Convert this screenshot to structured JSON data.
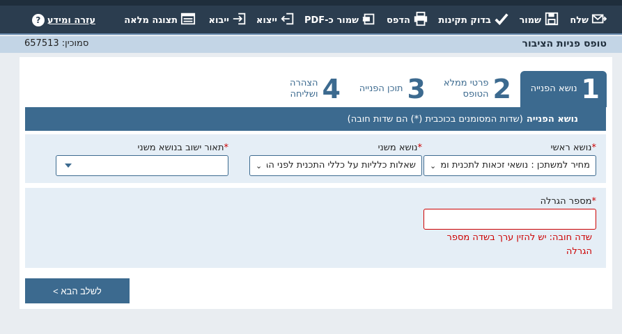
{
  "toolbar": {
    "send": "שלח",
    "save": "שמור",
    "validate": "בדוק תקינות",
    "print": "הדפס",
    "save_pdf": "שמור כ-PDF",
    "export": "ייצוא",
    "import": "ייבוא",
    "fullscreen": "תצוגה מלאה",
    "help": "עזרה ומידע",
    "help_icon": "?"
  },
  "header": {
    "title": "טופס פניות הציבור",
    "reference": "סמוכין: 657513"
  },
  "steps": [
    {
      "num": "1",
      "label": "נושא הפנייה"
    },
    {
      "num": "2",
      "label": "פרטי ממלא הטופס"
    },
    {
      "num": "3",
      "label": "תוכן הפנייה"
    },
    {
      "num": "4",
      "label": "הצהרה ושליחה"
    }
  ],
  "section": {
    "title": "נושא הפנייה",
    "note": "(שדות המסומנים בכוכבית (*) הם שדות חובה)"
  },
  "fields": {
    "req_mark": "*",
    "main_topic": {
      "label": "נושא ראשי",
      "value": "מחיר למשתכן : נושאי זכאות לתכנית ומי"
    },
    "sub_topic": {
      "label": "נושא משני",
      "value": "שאלות כלליות על כללי התכנית לפני הגר"
    },
    "settlement": {
      "label": "תאור ישוב בנושא משני",
      "value": ""
    },
    "lottery": {
      "label": "מספר הגרלה",
      "value": "",
      "error_line1": "שדה חובה: יש להזין ערך בשדה מספר",
      "error_line2": "הגרלה"
    }
  },
  "next_button": "לשלב הבא >"
}
